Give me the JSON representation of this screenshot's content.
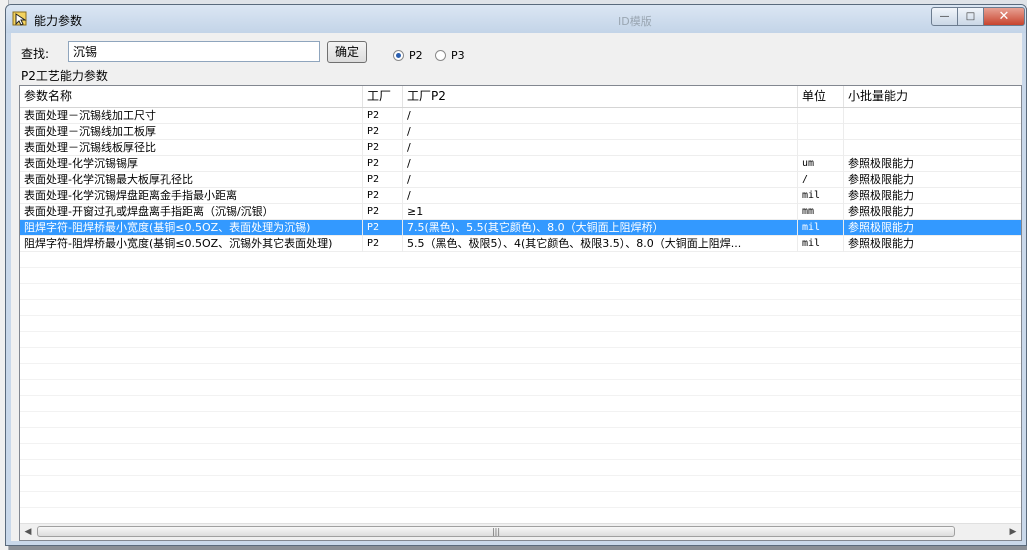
{
  "window": {
    "title": "能力参数",
    "background_ghost_text": "ID模版",
    "controls": {
      "minimize": "—",
      "maximize": "□",
      "close": "✕"
    }
  },
  "search": {
    "label": "查找:",
    "value": "沉锡",
    "button_label": "确定"
  },
  "radios": [
    {
      "label": "P2",
      "selected": true
    },
    {
      "label": "P3",
      "selected": false
    }
  ],
  "group_label": "P2工艺能力参数",
  "table": {
    "columns": [
      "参数名称",
      "工厂",
      "工厂P2",
      "单位",
      "小批量能力"
    ],
    "rows": [
      {
        "name": "表面处理－沉锡线加工尺寸",
        "factory": "P2",
        "factory_p2": "/",
        "unit": "",
        "capability": "",
        "selected": false
      },
      {
        "name": "表面处理－沉锡线加工板厚",
        "factory": "P2",
        "factory_p2": "/",
        "unit": "",
        "capability": "",
        "selected": false
      },
      {
        "name": "表面处理－沉锡线板厚径比",
        "factory": "P2",
        "factory_p2": "/",
        "unit": "",
        "capability": "",
        "selected": false
      },
      {
        "name": "表面处理-化学沉锡锡厚",
        "factory": "P2",
        "factory_p2": "/",
        "unit": "um",
        "capability": "参照极限能力",
        "selected": false
      },
      {
        "name": "表面处理-化学沉锡最大板厚孔径比",
        "factory": "P2",
        "factory_p2": "/",
        "unit": "/",
        "capability": "参照极限能力",
        "selected": false
      },
      {
        "name": "表面处理-化学沉锡焊盘距离金手指最小距离",
        "factory": "P2",
        "factory_p2": "/",
        "unit": "mil",
        "capability": "参照极限能力",
        "selected": false
      },
      {
        "name": "表面处理-开窗过孔或焊盘离手指距离（沉锡/沉银）",
        "factory": "P2",
        "factory_p2": "≥1",
        "unit": "mm",
        "capability": "参照极限能力",
        "selected": false
      },
      {
        "name": "阻焊字符-阻焊桥最小宽度(基铜≤0.5OZ、表面处理为沉锡)",
        "factory": "P2",
        "factory_p2": "7.5(黑色)、5.5(其它颜色)、8.0（大铜面上阻焊桥）",
        "unit": "mil",
        "capability": "参照极限能力",
        "selected": true
      },
      {
        "name": "阻焊字符-阻焊桥最小宽度(基铜≤0.5OZ、沉锡外其它表面处理)",
        "factory": "P2",
        "factory_p2": "5.5（黑色、极限5）、4(其它颜色、极限3.5）、8.0（大铜面上阻焊...",
        "unit": "mil",
        "capability": "参照极限能力",
        "selected": false
      }
    ]
  },
  "scrollbar": {
    "left_arrow": "◀",
    "right_arrow": "▶",
    "grip": "|||"
  },
  "colors": {
    "selection": "#3399ff",
    "titlebar": "#c9d8ea"
  }
}
